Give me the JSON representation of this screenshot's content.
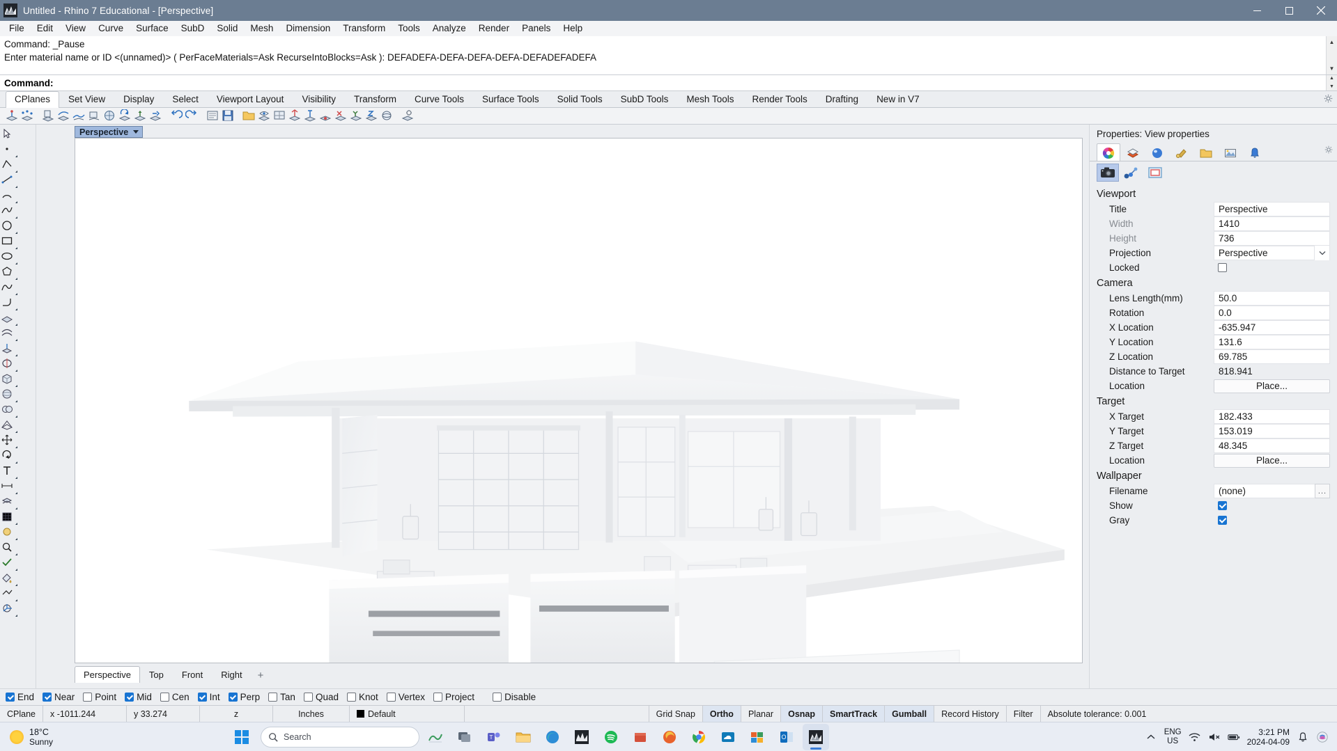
{
  "window": {
    "title": "Untitled - Rhino 7 Educational - [Perspective]",
    "minimize": "minimize-icon",
    "maximize": "maximize-icon",
    "close": "close-icon"
  },
  "menubar": {
    "items": [
      "File",
      "Edit",
      "View",
      "Curve",
      "Surface",
      "SubD",
      "Solid",
      "Mesh",
      "Dimension",
      "Transform",
      "Tools",
      "Analyze",
      "Render",
      "Panels",
      "Help"
    ]
  },
  "command": {
    "history": [
      "Command: _Pause",
      "Enter material name or ID <(unnamed)> ( PerFaceMaterials=Ask  RecurseIntoBlocks=Ask ): DEFADEFA-DEFA-DEFA-DEFA-DEFADEFADEFA"
    ],
    "prompt_label": "Command:",
    "input_value": ""
  },
  "toolbar_tabs": {
    "items": [
      "CPlanes",
      "Set View",
      "Display",
      "Select",
      "Viewport Layout",
      "Visibility",
      "Transform",
      "Curve Tools",
      "Surface Tools",
      "Solid Tools",
      "SubD Tools",
      "Mesh Tools",
      "Render Tools",
      "Drafting",
      "New in V7"
    ],
    "active": "CPlanes"
  },
  "viewport": {
    "label": "Perspective",
    "tabs": [
      "Perspective",
      "Top",
      "Front",
      "Right"
    ],
    "active_tab": "Perspective",
    "add_tab": "+"
  },
  "properties": {
    "panel_title": "Properties: View properties",
    "tabs_row1": [
      "color-wheel-icon",
      "layers-icon",
      "render-material-icon",
      "light-icon",
      "folder-icon",
      "image-icon",
      "bell-icon"
    ],
    "tabs_row2": [
      "camera-icon",
      "curve-points-icon",
      "viewport-frame-icon"
    ],
    "active_tab_row2": "camera-icon",
    "groups": [
      {
        "name": "Viewport",
        "rows": [
          {
            "key": "Title",
            "value": "Perspective",
            "type": "text",
            "dim": false
          },
          {
            "key": "Width",
            "value": "1410",
            "type": "text",
            "dim": true
          },
          {
            "key": "Height",
            "value": "736",
            "type": "text",
            "dim": true
          },
          {
            "key": "Projection",
            "value": "Perspective",
            "type": "select",
            "dim": false
          },
          {
            "key": "Locked",
            "value": "",
            "type": "checkbox",
            "checked": false,
            "dim": false
          }
        ]
      },
      {
        "name": "Camera",
        "rows": [
          {
            "key": "Lens Length(mm)",
            "value": "50.0",
            "type": "text",
            "dim": false
          },
          {
            "key": "Rotation",
            "value": "0.0",
            "type": "text",
            "dim": false
          },
          {
            "key": "X Location",
            "value": "-635.947",
            "type": "text",
            "dim": false
          },
          {
            "key": "Y Location",
            "value": "131.6",
            "type": "text",
            "dim": false
          },
          {
            "key": "Z Location",
            "value": "69.785",
            "type": "text",
            "dim": false
          },
          {
            "key": "Distance to Target",
            "value": "818.941",
            "type": "readonly",
            "dim": false
          },
          {
            "key": "Location",
            "value": "Place...",
            "type": "button",
            "dim": false
          }
        ]
      },
      {
        "name": "Target",
        "rows": [
          {
            "key": "X Target",
            "value": "182.433",
            "type": "text",
            "dim": false
          },
          {
            "key": "Y Target",
            "value": "153.019",
            "type": "text",
            "dim": false
          },
          {
            "key": "Z Target",
            "value": "48.345",
            "type": "text",
            "dim": false
          },
          {
            "key": "Location",
            "value": "Place...",
            "type": "button",
            "dim": false
          }
        ]
      },
      {
        "name": "Wallpaper",
        "rows": [
          {
            "key": "Filename",
            "value": "(none)",
            "type": "file",
            "dim": false
          },
          {
            "key": "Show",
            "value": "",
            "type": "checkbox",
            "checked": true,
            "dim": false
          },
          {
            "key": "Gray",
            "value": "",
            "type": "checkbox",
            "checked": true,
            "dim": false
          }
        ]
      }
    ]
  },
  "osnap": {
    "items": [
      {
        "label": "End",
        "checked": true
      },
      {
        "label": "Near",
        "checked": true
      },
      {
        "label": "Point",
        "checked": false
      },
      {
        "label": "Mid",
        "checked": true
      },
      {
        "label": "Cen",
        "checked": false
      },
      {
        "label": "Int",
        "checked": true
      },
      {
        "label": "Perp",
        "checked": true
      },
      {
        "label": "Tan",
        "checked": false
      },
      {
        "label": "Quad",
        "checked": false
      },
      {
        "label": "Knot",
        "checked": false
      },
      {
        "label": "Vertex",
        "checked": false
      },
      {
        "label": "Project",
        "checked": false
      },
      {
        "label": "Disable",
        "checked": false
      }
    ]
  },
  "statusbar": {
    "cplane_label": "CPlane",
    "x": "x -1011.244",
    "y": "y 33.274",
    "z": "z",
    "units": "Inches",
    "layer": "Default",
    "toggles": [
      {
        "label": "Grid Snap",
        "active": false
      },
      {
        "label": "Ortho",
        "active": true
      },
      {
        "label": "Planar",
        "active": false
      },
      {
        "label": "Osnap",
        "active": true
      },
      {
        "label": "SmartTrack",
        "active": true
      },
      {
        "label": "Gumball",
        "active": true
      },
      {
        "label": "Record History",
        "active": false
      },
      {
        "label": "Filter",
        "active": false
      }
    ],
    "tolerance": "Absolute tolerance: 0.001"
  },
  "taskbar": {
    "weather_temp": "18°C",
    "weather_desc": "Sunny",
    "search_placeholder": "Search",
    "language_line1": "ENG",
    "language_line2": "US",
    "time": "3:21 PM",
    "date": "2024-04-09",
    "apps": [
      "task-view-icon",
      "teams-icon",
      "file-explorer-icon",
      "edge-icon",
      "rhino-taskbar-icon",
      "spotify-icon",
      "store-icon",
      "firefox-icon",
      "chrome-icon",
      "onedrive-icon",
      "office-icon",
      "outlook-icon",
      "rhino-active-icon"
    ]
  },
  "colors": {
    "title_bar": "#6b7d92",
    "accent": "#1874d2",
    "panel_bg": "#eceef1",
    "viewport_bg": "#ffffff",
    "highlight": "#dde5f1"
  }
}
